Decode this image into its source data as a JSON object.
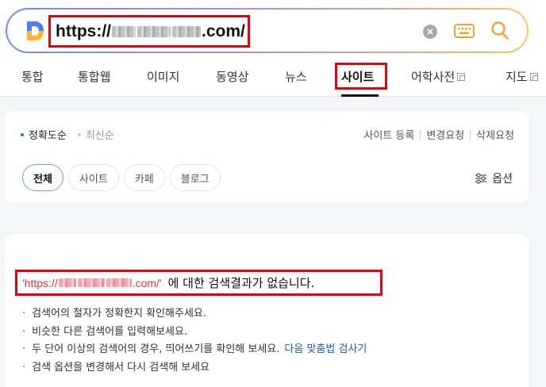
{
  "search": {
    "url_prefix": "https://",
    "url_suffix": ".com/"
  },
  "tabs": [
    {
      "label": "통합"
    },
    {
      "label": "통합웹"
    },
    {
      "label": "이미지"
    },
    {
      "label": "동영상"
    },
    {
      "label": "뉴스"
    },
    {
      "label": "사이트",
      "active": true
    },
    {
      "label": "어학사전",
      "external": true
    },
    {
      "label": "지도",
      "external": true
    }
  ],
  "sort": {
    "accurate": "정확도순",
    "latest": "최신순"
  },
  "links": {
    "register": "사이트 등록",
    "change": "변경요청",
    "delete": "삭제요청"
  },
  "chips": [
    "전체",
    "사이트",
    "카페",
    "블로그"
  ],
  "option_label": "옵션",
  "result": {
    "query_prefix": "'https://",
    "query_suffix": ".com/'",
    "message": "에 대한 검색결과가 없습니다.",
    "tips": [
      "검색어의 철자가 정확한지 확인해주세요.",
      "비슷한 다른 검색어를 입력해보세요.",
      "두 단어 이상의 검색어의 경우, 띄어쓰기를 확인해 보세요.",
      "검색 옵션을 변경해서 다시 검색해 보세요"
    ],
    "spell_link": "다음 맞춤법 검사기"
  },
  "colors": {
    "highlight_border": "#e8000b",
    "active_chip_border": "#6aa0ee",
    "link": "#1a5bd8",
    "accent_dot": "#1a73e8"
  }
}
